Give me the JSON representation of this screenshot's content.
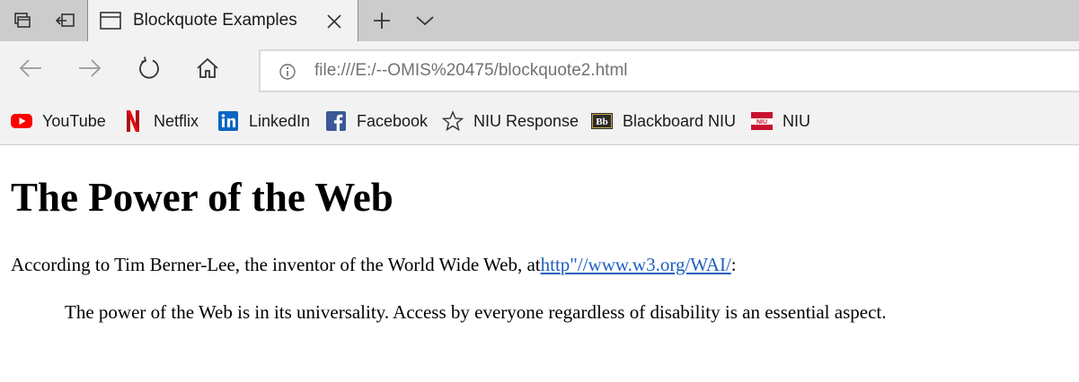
{
  "tab": {
    "title": "Blockquote Examples"
  },
  "address_bar": {
    "url": "file:///E:/--OMIS%20475/blockquote2.html"
  },
  "favorites": [
    {
      "label": "YouTube",
      "icon": "youtube-icon",
      "color": "#ff0000"
    },
    {
      "label": "Netflix",
      "icon": "netflix-icon",
      "color": "#e50914"
    },
    {
      "label": "LinkedIn",
      "icon": "linkedin-icon",
      "color": "#0a66c2"
    },
    {
      "label": "Facebook",
      "icon": "facebook-icon",
      "color": "#3b5998"
    },
    {
      "label": "NIU Response",
      "icon": "star-icon",
      "color": "#333333"
    },
    {
      "label": "Blackboard NIU",
      "icon": "blackboard-icon",
      "color": "#2b2b2b"
    },
    {
      "label": "NIU",
      "icon": "niu-icon",
      "color": "#c8102e",
      "icon_text": "NIU"
    }
  ],
  "blackboard_icon_text": "Bb",
  "page": {
    "heading": "The Power of the Web",
    "intro_text": "According to Tim Berner-Lee, the inventor of the World Wide Web, at",
    "link_text": "http\"//www.w3.org/WAI/",
    "intro_suffix": ":",
    "quote": "The power of the Web is in its universality. Access by everyone regardless of disability is an essential aspect."
  },
  "colors": {
    "tabstrip": "#cccccc",
    "toolbar": "#f2f2f2",
    "link": "#1f5fbf"
  }
}
